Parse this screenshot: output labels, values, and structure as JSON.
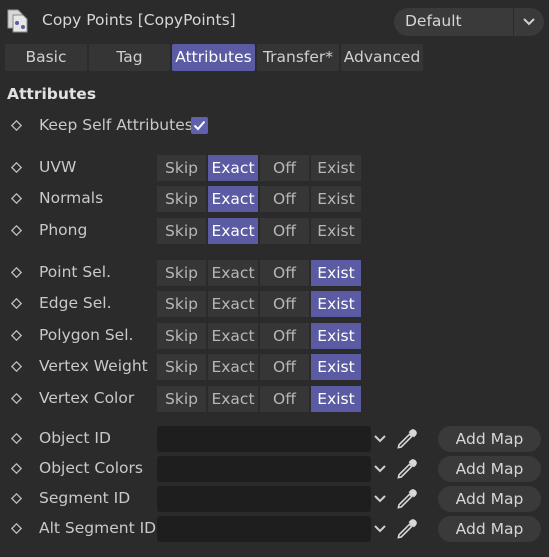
{
  "header": {
    "title": "Copy Points [CopyPoints]",
    "icon": "copy-points-object-icon",
    "preset": "Default"
  },
  "tabs": [
    {
      "label": "Basic",
      "active": false
    },
    {
      "label": "Tag",
      "active": false
    },
    {
      "label": "Attributes",
      "active": true
    },
    {
      "label": "Transfer*",
      "active": false
    },
    {
      "label": "Advanced",
      "active": false
    }
  ],
  "section_title": "Attributes",
  "keep_self": {
    "label": "Keep Self Attributes",
    "checked": true
  },
  "mode_options": [
    "Skip",
    "Exact",
    "Off",
    "Exist"
  ],
  "attributes": [
    {
      "label": "UVW",
      "selected": "Exact"
    },
    {
      "label": "Normals",
      "selected": "Exact"
    },
    {
      "label": "Phong",
      "selected": "Exact"
    },
    {
      "label": "Point Sel.",
      "selected": "Exist"
    },
    {
      "label": "Edge Sel.",
      "selected": "Exist"
    },
    {
      "label": "Polygon Sel.",
      "selected": "Exist"
    },
    {
      "label": "Vertex Weight",
      "selected": "Exist"
    },
    {
      "label": "Vertex Color",
      "selected": "Exist"
    }
  ],
  "maps": [
    {
      "label": "Object ID",
      "value": "",
      "button": "Add Map"
    },
    {
      "label": "Object Colors",
      "value": "",
      "button": "Add Map"
    },
    {
      "label": "Segment ID",
      "value": "",
      "button": "Add Map"
    },
    {
      "label": "Alt Segment ID",
      "value": "",
      "button": "Add Map"
    }
  ],
  "colors": {
    "accent": "#5b5ba3",
    "background": "#2b2b2b"
  }
}
